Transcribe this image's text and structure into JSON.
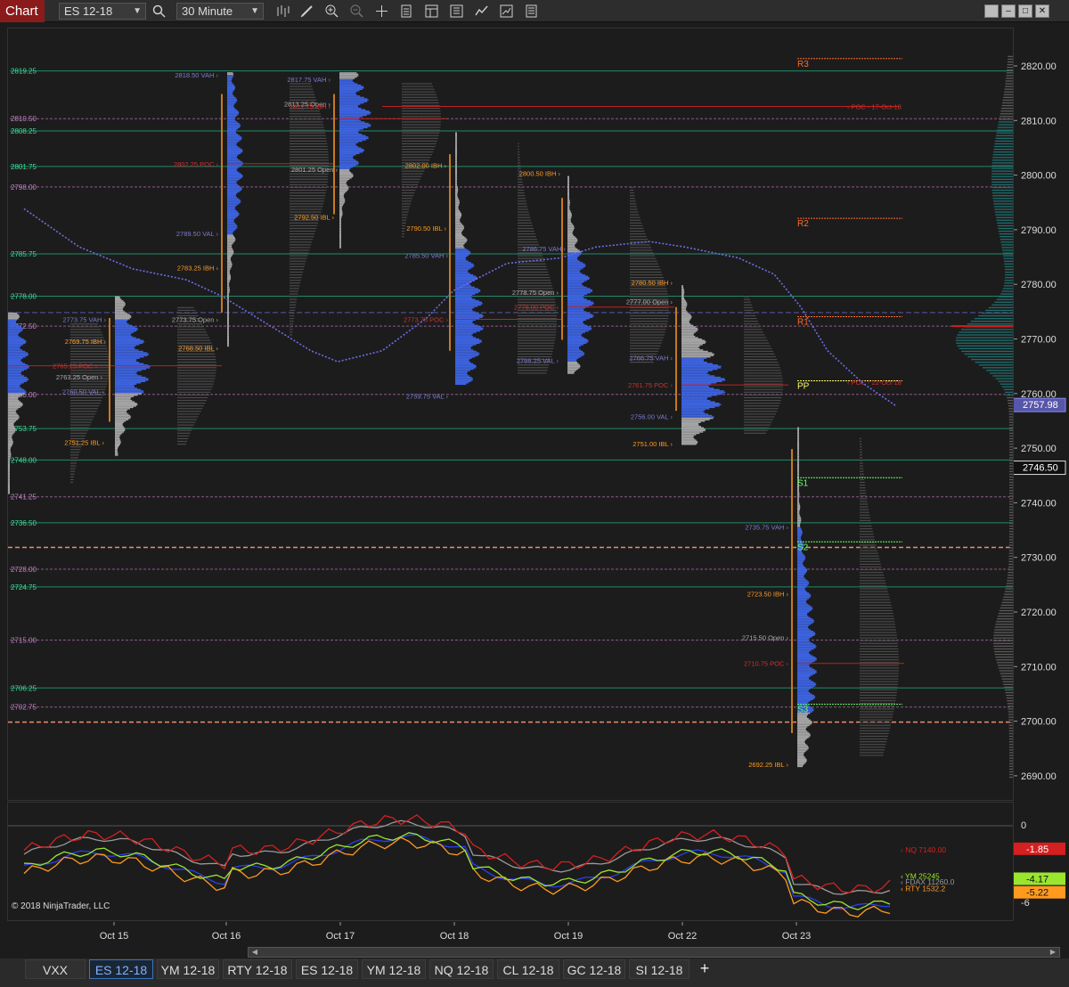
{
  "toolbar": {
    "chart_label": "Chart",
    "instrument": "ES 12-18",
    "interval": "30 Minute",
    "icons": [
      "search-icon",
      "bar-type-icon",
      "draw-tool-icon",
      "zoom-in-icon",
      "zoom-out-icon",
      "crosshair-icon",
      "data-box-icon",
      "templates-icon",
      "strategies-icon",
      "properties-icon",
      "chart-trader-icon"
    ],
    "window_buttons": [
      "minimize",
      "restore",
      "maximize",
      "close"
    ]
  },
  "price_axis": {
    "ticks": [
      "2820.00",
      "2810.00",
      "2800.00",
      "2790.00",
      "2780.00",
      "2770.00",
      "2760.00",
      "2750.00",
      "2740.00",
      "2730.00",
      "2720.00",
      "2710.00",
      "2700.00",
      "2690.00"
    ],
    "badge_vwap": "2757.98",
    "badge_last": "2746.50"
  },
  "level_labels": [
    "2819.25",
    "2810.50",
    "2808.25",
    "2801.75",
    "2798.00",
    "2785.75",
    "2778.00",
    "2772.50",
    "2760.00",
    "2753.75",
    "2748.00",
    "2741.25",
    "2736.50",
    "2728.00",
    "2724.75",
    "2715.00",
    "2706.25",
    "2702.75"
  ],
  "profile_labels": {
    "oct15": [
      "2773.75 VAH",
      "2769.75 IBH",
      "2765.25 POC",
      "2763.25 Open",
      "2760.50 VAL",
      "2751.25 IBL"
    ],
    "oct16": [
      "2818.50 VAH",
      "2802.25 POC",
      "2789.50 VAL",
      "2783.25 IBH",
      "2773.75 Open",
      "2768.50 IBL"
    ],
    "oct17": [
      "2817.75 VAH",
      "2813.25 Open",
      "2812.75 IBH",
      "2801.25 Open",
      "2792.50 IBL"
    ],
    "oct18": [
      "2802.00 IBH",
      "2790.50 IBL",
      "2786.75 VAH",
      "2785.50 VAH",
      "2773.75 POC",
      "2759.75 VAL"
    ],
    "oct19": [
      "2800.50 IBH",
      "2778.75 Open",
      "2776.00 POC",
      "2766.25 VAL"
    ],
    "oct22": [
      "2780.50 IBH",
      "2777.00 Open",
      "2766.75 VAH",
      "2761.75 POC",
      "2756.00 VAL",
      "2751.00 IBL"
    ],
    "oct23": [
      "2735.75 VAH",
      "2723.50 IBH",
      "2715.50 Open",
      "2710.75 POC",
      "2692.25 IBL"
    ]
  },
  "pivots": [
    "R3",
    "R2",
    "R1",
    "PP",
    "S1",
    "S2",
    "S3"
  ],
  "poc_notes": [
    "POC - 17-Oct-18",
    "POC - 22-Oct-18"
  ],
  "indicator": {
    "scale": [
      "0",
      "-6"
    ],
    "labels": {
      "nq": "NQ 7140.00",
      "ym": "YM 25245",
      "fdax": "FDAX 11260.0",
      "rty": "RTY 1532.2"
    },
    "badges": {
      "nq": "-1.85",
      "ym": "-4.17",
      "fdax": "-5.22"
    },
    "colors": {
      "nq": "#d42020",
      "ym": "#9ae62e",
      "fdax": "#9a9a9a",
      "rty": "#ff9a1f",
      "base": "#2a3ef0"
    }
  },
  "copyright": "© 2018 NinjaTrader, LLC",
  "dates": [
    "Oct 15",
    "Oct 16",
    "Oct 17",
    "Oct 18",
    "Oct 19",
    "Oct 22",
    "Oct 23"
  ],
  "tabs": [
    "VXX",
    "ES 12-18",
    "YM 12-18",
    "RTY 12-18",
    "ES 12-18",
    "YM 12-18",
    "NQ 12-18",
    "CL 12-18",
    "GC 12-18",
    "SI 12-18"
  ],
  "active_tab": "ES 12-18",
  "colors": {
    "accent": "#3b74b8",
    "chart_tab": "#8b1a1a",
    "profile_blue": "#3d63e0",
    "profile_gray": "#a5a5a5",
    "vwap": "#6d6de8"
  }
}
